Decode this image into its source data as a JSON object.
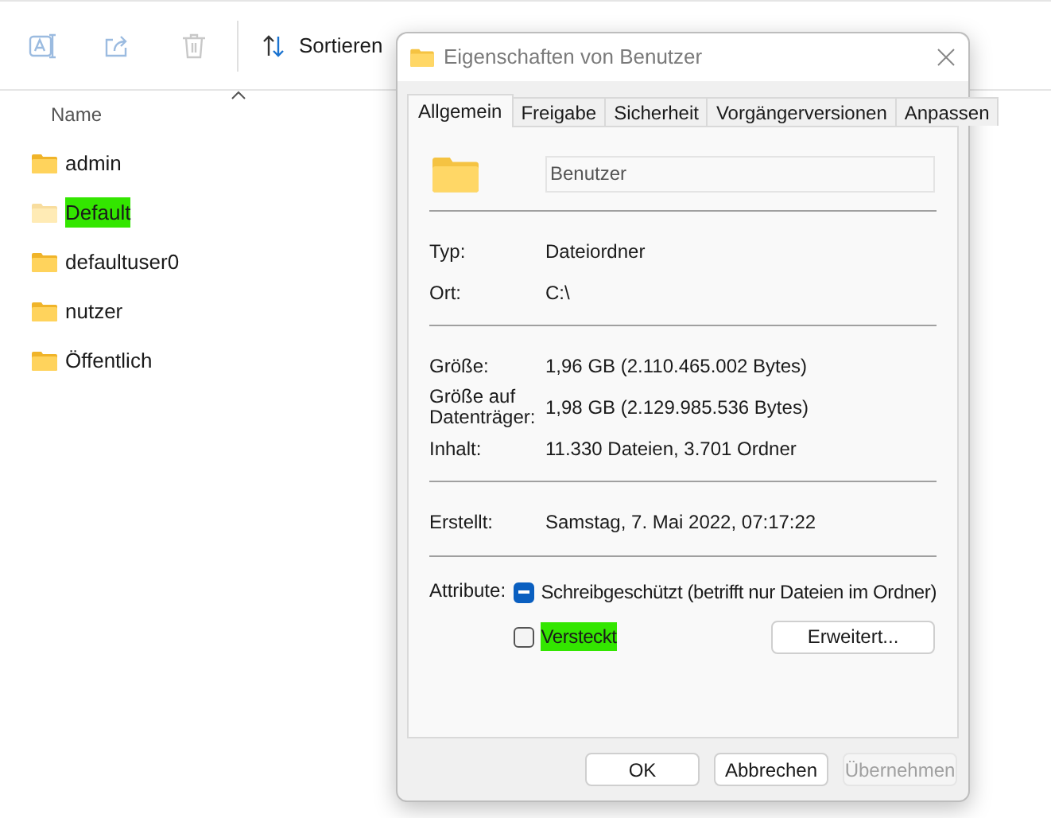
{
  "explorer": {
    "toolbar": {
      "sort_label": "Sortieren"
    },
    "column_header": "Name",
    "items": [
      {
        "name": "admin",
        "hidden": false,
        "highlighted": false
      },
      {
        "name": "Default",
        "hidden": true,
        "highlighted": true
      },
      {
        "name": "defaultuser0",
        "hidden": false,
        "highlighted": false
      },
      {
        "name": "nutzer",
        "hidden": false,
        "highlighted": false
      },
      {
        "name": "Öffentlich",
        "hidden": false,
        "highlighted": false
      }
    ]
  },
  "dialog": {
    "title": "Eigenschaften von Benutzer",
    "tabs": [
      {
        "label": "Allgemein",
        "selected": true
      },
      {
        "label": "Freigabe",
        "selected": false
      },
      {
        "label": "Sicherheit",
        "selected": false
      },
      {
        "label": "Vorgängerversionen",
        "selected": false
      },
      {
        "label": "Anpassen",
        "selected": false
      }
    ],
    "name_field": {
      "value": "Benutzer"
    },
    "sections": [
      [
        {
          "label": "Typ:",
          "value": "Dateiordner"
        },
        {
          "label": "Ort:",
          "value": "C:\\"
        }
      ],
      [
        {
          "label": "Größe:",
          "value": "1,96 GB (2.110.465.002 Bytes)"
        },
        {
          "label": "Größe auf Datenträger:",
          "value": "1,98 GB (2.129.985.536 Bytes)"
        },
        {
          "label": "Inhalt:",
          "value": "11.330 Dateien, 3.701 Ordner"
        }
      ],
      [
        {
          "label": "Erstellt:",
          "value": "Samstag, 7. Mai 2022, 07:17:22"
        }
      ]
    ],
    "attributes_label": "Attribute:",
    "attributes": [
      {
        "label": "Schreibgeschützt (betrifft nur Dateien im Ordner)",
        "indeterminate": true,
        "highlighted": false
      },
      {
        "label": "Versteckt",
        "indeterminate": false,
        "highlighted": true
      }
    ],
    "advanced_button": "Erweitert...",
    "buttons": [
      {
        "label": "OK",
        "disabled": false
      },
      {
        "label": "Abbrechen",
        "disabled": false
      },
      {
        "label": "Übernehmen",
        "disabled": true
      }
    ]
  }
}
